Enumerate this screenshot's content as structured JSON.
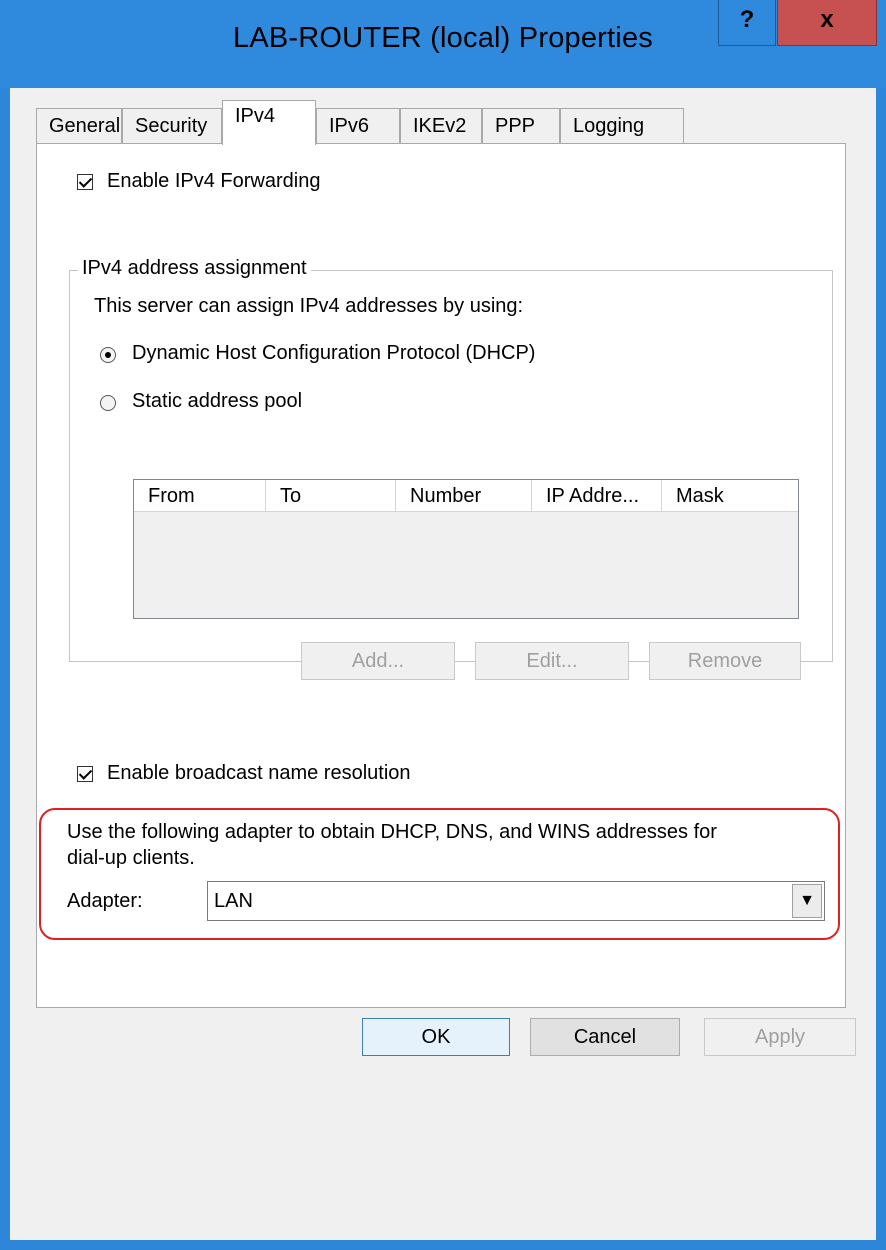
{
  "window": {
    "title": "LAB-ROUTER (local) Properties",
    "help_label": "?",
    "close_label": "x"
  },
  "tabs": [
    {
      "label": "General",
      "active": false
    },
    {
      "label": "Security",
      "active": false
    },
    {
      "label": "IPv4",
      "active": true
    },
    {
      "label": "IPv6",
      "active": false
    },
    {
      "label": "IKEv2",
      "active": false
    },
    {
      "label": "PPP",
      "active": false
    },
    {
      "label": "Logging",
      "active": false
    }
  ],
  "ipv4": {
    "enable_forwarding": {
      "label": "Enable IPv4 Forwarding",
      "checked": true
    },
    "assignment": {
      "group_title": "IPv4 address assignment",
      "description": "This server can assign IPv4 addresses by using:",
      "dhcp_option": {
        "label": "Dynamic Host Configuration Protocol (DHCP)",
        "selected": true
      },
      "static_option": {
        "label": "Static address pool",
        "selected": false
      },
      "pool_columns": [
        "From",
        "To",
        "Number",
        "IP Addre...",
        "Mask"
      ],
      "pool_rows": [],
      "add_label": "Add...",
      "edit_label": "Edit...",
      "remove_label": "Remove"
    },
    "broadcast_resolution": {
      "label": "Enable broadcast name resolution",
      "checked": true
    },
    "adapter_section": {
      "description_line1": "Use the following adapter to obtain DHCP, DNS, and WINS addresses for",
      "description_line2": "dial-up clients.",
      "adapter_label": "Adapter:",
      "adapter_value": "LAN",
      "highlight_color": "#e02020"
    }
  },
  "footer": {
    "ok_label": "OK",
    "cancel_label": "Cancel",
    "apply_label": "Apply"
  },
  "colors": {
    "title_bar": "#2f89dc",
    "close_button": "#c75050",
    "dialog_bg": "#f0f0f0"
  }
}
